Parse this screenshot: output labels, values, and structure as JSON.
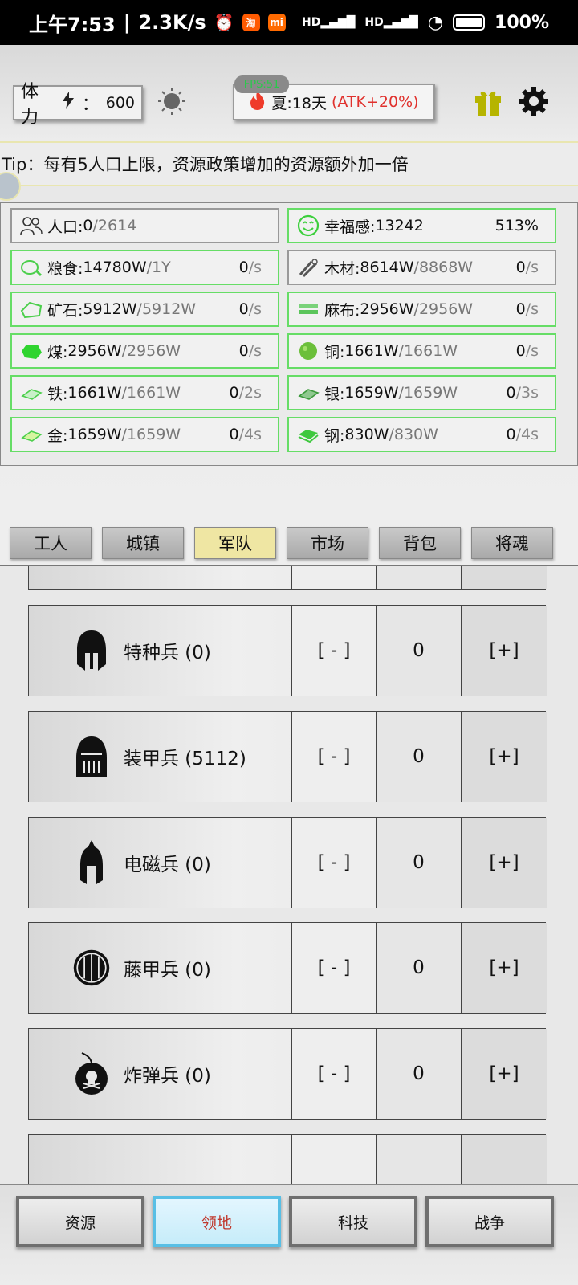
{
  "status_bar": {
    "time": "上午7:53",
    "speed": "2.3K/s",
    "network_left": "HD",
    "network_right": "HD",
    "battery": "100%",
    "app_badge_taobao": "淘",
    "app_badge_mi": "mi"
  },
  "header": {
    "stamina_label": "体力",
    "stamina_sep": "：",
    "stamina_value": "600",
    "fps_label": "FPS:51",
    "season_text": "夏:18天",
    "season_bonus": "(ATK+20%)",
    "icons": [
      "sun-icon",
      "fire-icon",
      "gift-icon",
      "gear-icon"
    ]
  },
  "tip": "Tip：每有5人口上限，资源政策增加的资源额外加一倍",
  "resources": [
    {
      "name": "人口",
      "value": "0",
      "cap": "2614",
      "rate": "",
      "unit": "",
      "extra": "",
      "icon": "population-icon",
      "border": "gray"
    },
    {
      "name": "幸福感",
      "value": "13242",
      "cap": "",
      "rate": "",
      "unit": "",
      "extra": "513%",
      "icon": "smile-icon",
      "border": "green"
    },
    {
      "name": "粮食",
      "value": "14780W",
      "cap": "1Y",
      "rate": "0",
      "unit": "/s",
      "extra": "",
      "icon": "food-icon",
      "border": "green"
    },
    {
      "name": "木材",
      "value": "8614W",
      "cap": "8868W",
      "rate": "0",
      "unit": "/s",
      "extra": "",
      "icon": "wood-icon",
      "border": "gray"
    },
    {
      "name": "矿石",
      "value": "5912W",
      "cap": "5912W",
      "rate": "0",
      "unit": "/s",
      "extra": "",
      "icon": "ore-icon",
      "border": "green"
    },
    {
      "name": "麻布",
      "value": "2956W",
      "cap": "2956W",
      "rate": "0",
      "unit": "/s",
      "extra": "",
      "icon": "cloth-icon",
      "border": "green"
    },
    {
      "name": "煤",
      "value": "2956W",
      "cap": "2956W",
      "rate": "0",
      "unit": "/s",
      "extra": "",
      "icon": "coal-icon",
      "border": "green"
    },
    {
      "name": "铜",
      "value": "1661W",
      "cap": "1661W",
      "rate": "0",
      "unit": "/s",
      "extra": "",
      "icon": "copper-icon",
      "border": "green"
    },
    {
      "name": "铁",
      "value": "1661W",
      "cap": "1661W",
      "rate": "0",
      "unit": "/2s",
      "extra": "",
      "icon": "iron-icon",
      "border": "green"
    },
    {
      "name": "银",
      "value": "1659W",
      "cap": "1659W",
      "rate": "0",
      "unit": "/3s",
      "extra": "",
      "icon": "silver-icon",
      "border": "green"
    },
    {
      "name": "金",
      "value": "1659W",
      "cap": "1659W",
      "rate": "0",
      "unit": "/4s",
      "extra": "",
      "icon": "gold-icon",
      "border": "green"
    },
    {
      "name": "钢",
      "value": "830W",
      "cap": "830W",
      "rate": "0",
      "unit": "/4s",
      "extra": "",
      "icon": "steel-icon",
      "border": "green"
    }
  ],
  "tabs": [
    "工人",
    "城镇",
    "军队",
    "市场",
    "背包",
    "将魂"
  ],
  "active_tab": "军队",
  "army": {
    "minus_label": "[ - ]",
    "plus_label": "[+]",
    "units": [
      {
        "label": "",
        "count": "",
        "icon": "partial-unit-icon"
      },
      {
        "label": "特种兵 (0)",
        "count": "0",
        "icon": "spartan-helmet-icon"
      },
      {
        "label": "装甲兵 (5112)",
        "count": "0",
        "icon": "knight-helmet-icon"
      },
      {
        "label": "电磁兵 (0)",
        "count": "0",
        "icon": "crested-helmet-icon"
      },
      {
        "label": "藤甲兵 (0)",
        "count": "0",
        "icon": "round-shield-icon"
      },
      {
        "label": "炸弹兵 (0)",
        "count": "0",
        "icon": "skull-bomb-icon"
      },
      {
        "label": "",
        "count": "",
        "icon": "partial-unit-icon"
      }
    ]
  },
  "bottom_nav": [
    "资源",
    "领地",
    "科技",
    "战争"
  ],
  "active_nav": "领地",
  "colors": {
    "green_border": "#66dd66",
    "active_tab": "#efe6a3",
    "active_nav_border": "#58bfe5",
    "atk_red": "#e0312d"
  }
}
